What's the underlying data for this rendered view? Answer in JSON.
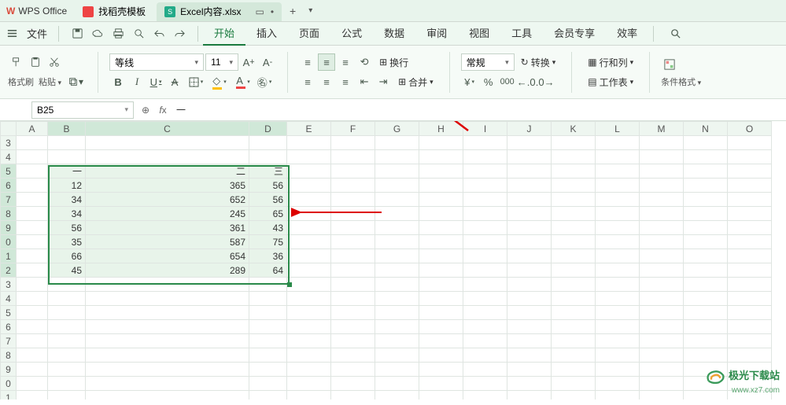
{
  "app": {
    "name": "WPS Office"
  },
  "tabs": [
    {
      "label": "找稻壳模板",
      "active": false
    },
    {
      "label": "Excel内容.xlsx",
      "active": true
    }
  ],
  "menu_file": "文件",
  "menu": {
    "start": "开始",
    "insert": "插入",
    "page": "页面",
    "formula": "公式",
    "data": "数据",
    "review": "审阅",
    "view": "视图",
    "tools": "工具",
    "member": "会员专享",
    "efficiency": "效率"
  },
  "ribbon": {
    "format_painter": "格式刷",
    "paste": "粘贴",
    "font_name": "等线",
    "font_size": "11",
    "wrap": "换行",
    "merge": "合并",
    "number_format": "常规",
    "convert": "转换",
    "rowcol": "行和列",
    "sheet": "工作表",
    "cond_format": "条件格式"
  },
  "namebox": "B25",
  "formula": "一",
  "columns": [
    "A",
    "B",
    "C",
    "D",
    "E",
    "F",
    "G",
    "H",
    "I",
    "J",
    "K",
    "L",
    "M",
    "N",
    "O"
  ],
  "col_widths": {
    "A": 40,
    "B": 48,
    "C": 208,
    "D": 48,
    "default": 56
  },
  "rows_visible": [
    "3",
    "4",
    "5",
    "6",
    "7",
    "8",
    "9",
    "0",
    "1",
    "2",
    "3",
    "4",
    "5",
    "6",
    "7",
    "8",
    "9",
    "0",
    "1"
  ],
  "headers": {
    "b": "一",
    "c": "二",
    "d": "三"
  },
  "chart_data": {
    "type": "table",
    "columns": [
      "一",
      "二",
      "三"
    ],
    "rows": [
      [
        12,
        365,
        56
      ],
      [
        34,
        652,
        56
      ],
      [
        34,
        245,
        65
      ],
      [
        56,
        361,
        43
      ],
      [
        35,
        587,
        75
      ],
      [
        66,
        654,
        36
      ],
      [
        45,
        289,
        64
      ]
    ]
  },
  "watermark": {
    "line1": "极光下载站",
    "line2": "www.xz7.com"
  }
}
